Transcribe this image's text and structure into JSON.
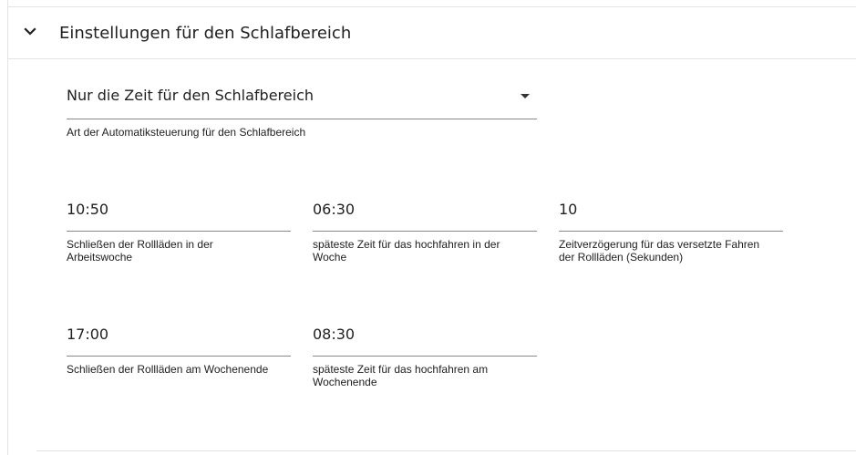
{
  "section": {
    "title": "Einstellungen für den Schlafbereich",
    "expand_icon": "chevron-down-icon"
  },
  "mode_select": {
    "value": "Nur die Zeit für den Schlafbereich",
    "helper": "Art der Automatiksteuerung für den Schlafbereich",
    "icon": "dropdown-arrow-icon"
  },
  "fields": [
    {
      "value": "10:50",
      "helper": "Schließen der Rollläden in der Arbeitswoche"
    },
    {
      "value": "06:30",
      "helper": "späteste Zeit für das hochfahren in der Woche"
    },
    {
      "value": "10",
      "helper": "Zeitverzögerung für das versetzte Fahren der Rollläden (Sekunden)"
    },
    {
      "value": "17:00",
      "helper": "Schließen der Rollläden am Wochenende"
    },
    {
      "value": "08:30",
      "helper": "späteste Zeit für das hochfahren am Wochenende"
    }
  ],
  "colors": {
    "text": "#212121",
    "underline": "#8a8a8a",
    "divider": "#e3e3e3",
    "background": "#ffffff"
  }
}
